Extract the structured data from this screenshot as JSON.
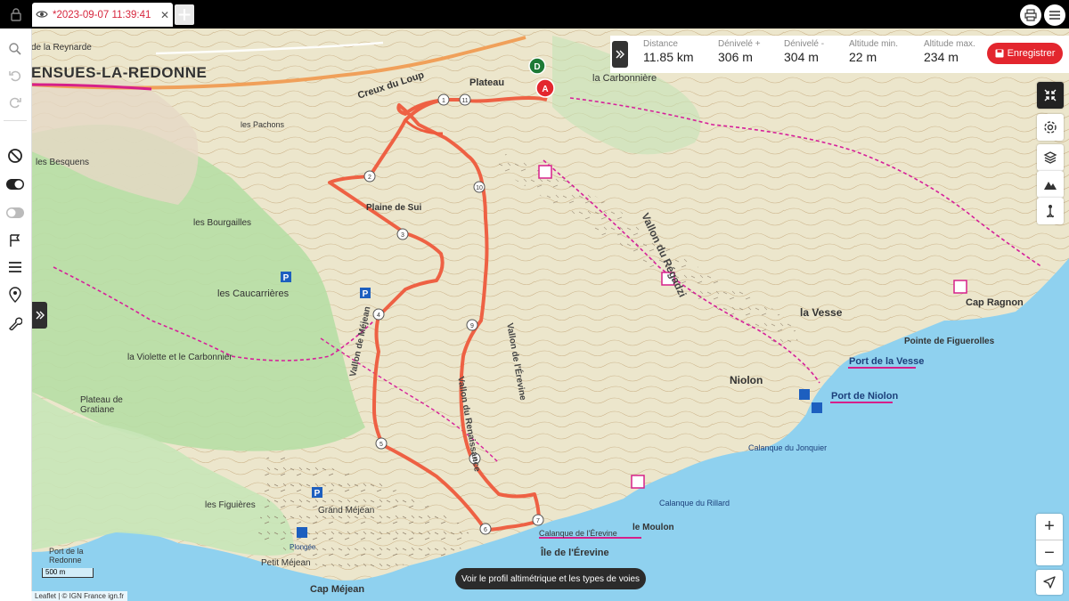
{
  "tab": {
    "title": "*2023-09-07 11:39:41"
  },
  "stats": [
    {
      "label": "Distance",
      "value": "11.85 km"
    },
    {
      "label": "Dénivelé +",
      "value": "306 m"
    },
    {
      "label": "Dénivelé -",
      "value": "304 m"
    },
    {
      "label": "Altitude min.",
      "value": "22 m"
    },
    {
      "label": "Altitude max.",
      "value": "234 m"
    }
  ],
  "save_label": "Enregistrer",
  "profile_button": "Voir le profil altimétrique et les types de voies",
  "attribution": "Leaflet | © IGN France ign.fr",
  "scale_label": "500 m",
  "zoom": {
    "in": "+",
    "out": "−"
  },
  "route": {
    "waypoints": [
      "1",
      "2",
      "3",
      "4",
      "5",
      "6",
      "7",
      "8",
      "9",
      "10",
      "11"
    ],
    "start_label": "D",
    "end_label": "A"
  },
  "map_labels": [
    {
      "key": "ensues",
      "text": "ENSUES-LA-REDONNE"
    },
    {
      "key": "reynarde",
      "text": "de la Reynarde"
    },
    {
      "key": "creux",
      "text": "Creux du Loup"
    },
    {
      "key": "plateau",
      "text": "Plateau"
    },
    {
      "key": "carbonniere",
      "text": "la Carbonnière"
    },
    {
      "key": "pachons",
      "text": "les Pachons"
    },
    {
      "key": "besquens",
      "text": "les Besquens"
    },
    {
      "key": "plaine",
      "text": "Plaine de Sui"
    },
    {
      "key": "bourgailles",
      "text": "les Bourgailles"
    },
    {
      "key": "caucarrieres",
      "text": "les Caucarrières"
    },
    {
      "key": "violette",
      "text": "la Violette et le Carbonnier"
    },
    {
      "key": "gratiane",
      "text": "Plateau de Gratiane"
    },
    {
      "key": "vallon_regadzi",
      "text": "Vallon du Régadzi"
    },
    {
      "key": "vesse",
      "text": "la Vesse"
    },
    {
      "key": "cap_ragnon",
      "text": "Cap Ragnon"
    },
    {
      "key": "figuerolles",
      "text": "Pointe de Figuerolles"
    },
    {
      "key": "port_vesse",
      "text": "Port de la Vesse"
    },
    {
      "key": "niolon",
      "text": "Niolon"
    },
    {
      "key": "port_niolon",
      "text": "Port de Niolon"
    },
    {
      "key": "jonquier",
      "text": "Calanque du Jonquier"
    },
    {
      "key": "rillard",
      "text": "Calanque du Rillard"
    },
    {
      "key": "moulon",
      "text": "le Moulon"
    },
    {
      "key": "calanque_erevine",
      "text": "Calanque de l'Érevine"
    },
    {
      "key": "ile_erevine",
      "text": "Île de l'Érevine"
    },
    {
      "key": "cap_mejean",
      "text": "Cap Méjean"
    },
    {
      "key": "grand_mejean",
      "text": "Grand Méjean"
    },
    {
      "key": "petit_mejean",
      "text": "Petit Méjean"
    },
    {
      "key": "figuieres",
      "text": "les Figuières"
    },
    {
      "key": "port_redonne",
      "text": "Port de la Redonne"
    },
    {
      "key": "vallon_mejean",
      "text": "Vallon de Méjean"
    },
    {
      "key": "vallon_erevine",
      "text": "Vallon de l'Érevine"
    },
    {
      "key": "vallon_renaissance",
      "text": "Vallon du Renaissance"
    },
    {
      "key": "plongee",
      "text": "Plongée"
    }
  ],
  "colors": {
    "route": "#ee5a3c",
    "accent": "#e3262e",
    "sea": "#8fd1ef",
    "terrain": "#e8e2c8",
    "forest": "#a9d99a"
  }
}
